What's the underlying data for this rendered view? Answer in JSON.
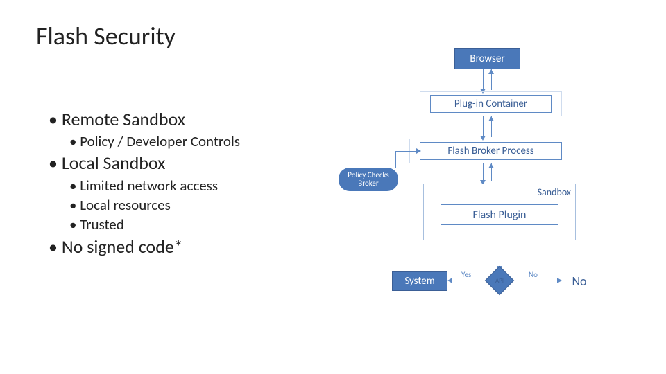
{
  "title": "Flash Security",
  "bullets": {
    "remote": "Remote Sandbox",
    "policy": "Policy / Developer Controls",
    "local": "Local Sandbox",
    "limited": "Limited network access",
    "localres": "Local resources",
    "trusted": "Trusted",
    "nosigned": "No signed code*"
  },
  "diagram": {
    "browser": "Browser",
    "plugin_container": "Plug-in Container",
    "broker": "Flash Broker Process",
    "policy_pill_1": "Policy Checks",
    "policy_pill_2": "Broker",
    "sandbox": "Sandbox",
    "flash_plugin": "Flash Plugin",
    "system": "System",
    "api": "API",
    "yes": "Yes",
    "no_edge": "No",
    "no": "No"
  }
}
